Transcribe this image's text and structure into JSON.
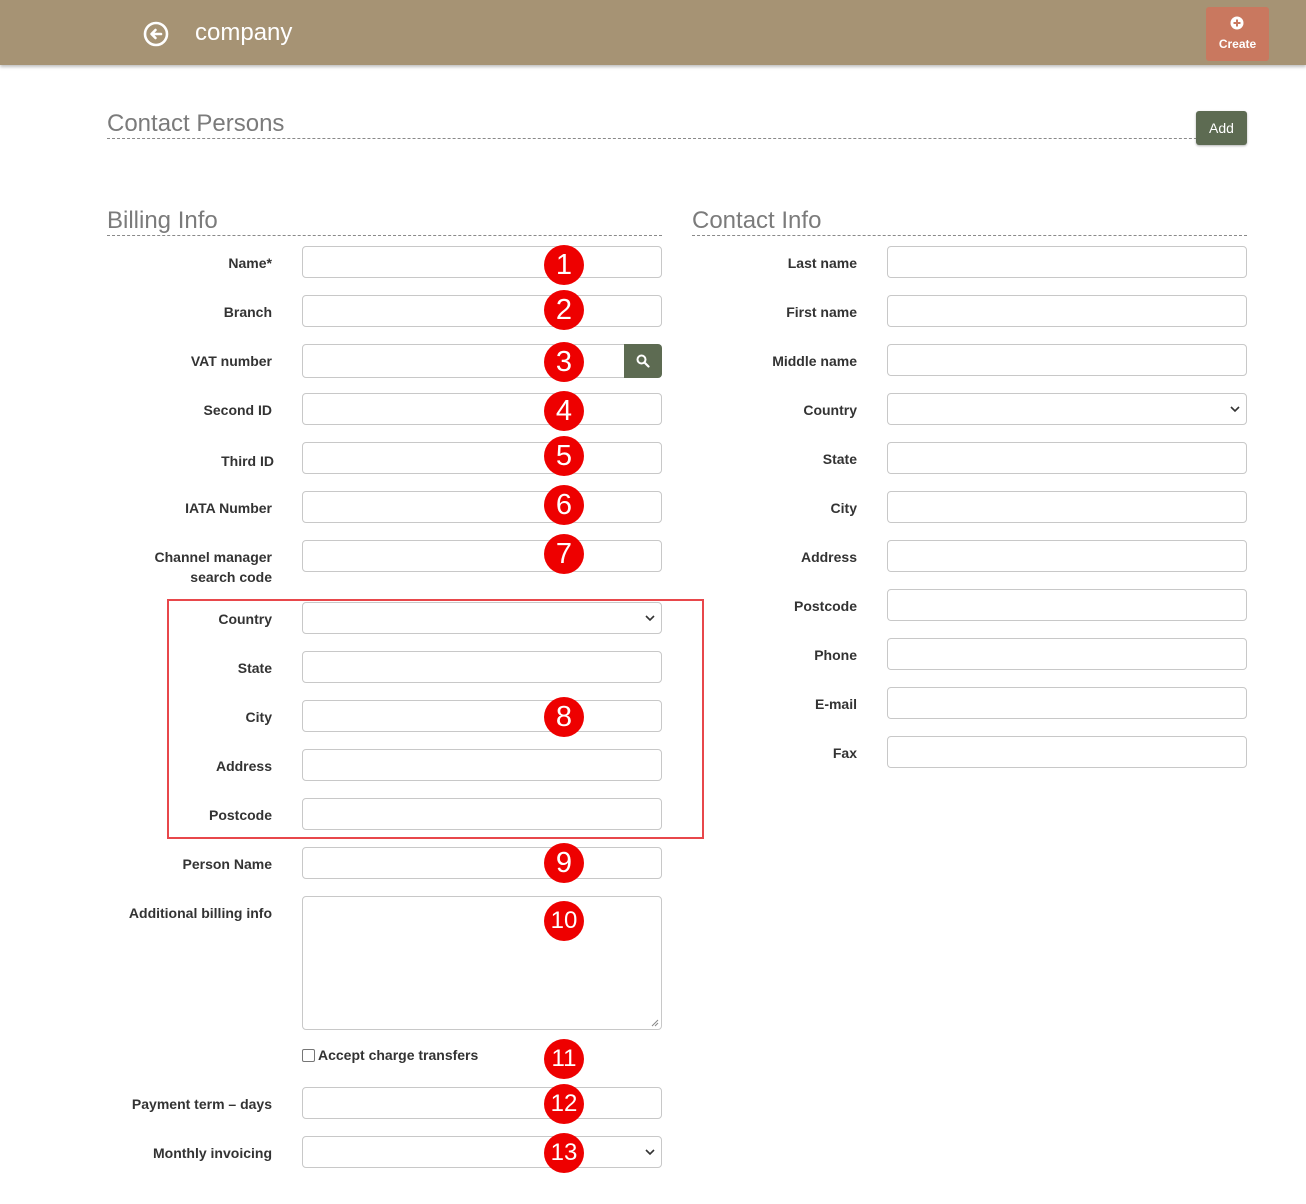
{
  "header": {
    "title": "company",
    "create_label": "Create",
    "color": "#a69374"
  },
  "contact_persons": {
    "title": "Contact Persons",
    "add_label": "Add"
  },
  "billing": {
    "title": "Billing Info",
    "fields": {
      "name": "Name*",
      "branch": "Branch",
      "vat": "VAT number",
      "second_id": "Second ID",
      "third_id": "Third ID",
      "iata": "IATA Number",
      "channel_line1": "Channel manager",
      "channel_line2": "search code",
      "country": "Country",
      "state": "State",
      "city": "City",
      "address": "Address",
      "postcode": "Postcode",
      "person_name": "Person Name",
      "additional": "Additional billing info",
      "accept": "Accept charge transfers",
      "payment_term": "Payment term – days",
      "monthly": "Monthly invoicing"
    }
  },
  "contact": {
    "title": "Contact Info",
    "fields": {
      "last_name": "Last name",
      "first_name": "First name",
      "middle_name": "Middle name",
      "country": "Country",
      "state": "State",
      "city": "City",
      "address": "Address",
      "postcode": "Postcode",
      "phone": "Phone",
      "email": "E-mail",
      "fax": "Fax"
    }
  },
  "annotations": [
    "1",
    "2",
    "3",
    "4",
    "5",
    "6",
    "7",
    "8",
    "9",
    "10",
    "11",
    "12",
    "13"
  ],
  "icons": {
    "back": "back-arrow-circle-icon",
    "create": "plus-circle-icon",
    "search": "search-icon",
    "dropdown": "chevron-down-icon"
  },
  "colors": {
    "accent_button": "#5d6b52",
    "create_button": "#c9785f",
    "annotation_badge": "#ee0000",
    "highlight_box": "#e8474b"
  }
}
